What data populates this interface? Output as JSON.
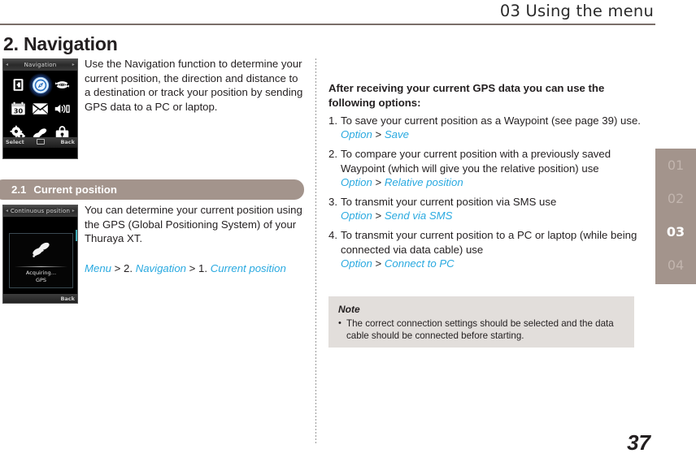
{
  "header": {
    "chapter_label": "03 Using the menu"
  },
  "section": {
    "title": "2. Navigation",
    "intro": "Use the Navigation function to determine your current position, the direction and distance to a destination or track your position by sending GPS data to a PC or laptop."
  },
  "subsection": {
    "number": "2.1",
    "title": "Current position",
    "body": "You can determine your current position using the GPS (Global Positioning System) of your Thuraya XT.",
    "path": {
      "menu": "Menu",
      "sep1": " > ",
      "step1_num": "2. ",
      "step1": "Navigation",
      "sep2": " > ",
      "step2_num": "1. ",
      "step2": "Current position"
    }
  },
  "phone_shots": [
    {
      "name": "navigation-menu-screen",
      "title": "Navigation",
      "arrow_left": "◂",
      "arrow_right": "▸",
      "icons": [
        "phonebook-icon",
        "compass-icon",
        "call-log-icon",
        "calendar-icon",
        "messages-icon",
        "sound-settings-icon",
        "settings-gear-icon",
        "satellite-icon",
        "security-lock-icon"
      ],
      "calendar_day": "30",
      "softkey_left": "Select",
      "softkey_middle": "menu-grid-icon",
      "softkey_right": "Back"
    },
    {
      "name": "continuous-position-screen",
      "title": "Continuous position",
      "arrow_left": "◂",
      "arrow_right": "▸",
      "status_icon": "satellite-icon",
      "status_line1": "Acquiring…",
      "status_line2": "GPS",
      "softkey_left": "",
      "softkey_right": "Back"
    }
  ],
  "options": {
    "lead": "After receiving your current GPS data you can use the following options:",
    "items": [
      {
        "index": "1.",
        "text": "To save your current position as a Waypoint (see page 39) use.",
        "path_prefix": "Option",
        "path_sep": " > ",
        "path_value": "Save"
      },
      {
        "index": "2.",
        "text": "To compare your current position with a previously saved Waypoint (which will give you the relative position) use",
        "path_prefix": "Option",
        "path_sep": " > ",
        "path_value": "Relative position"
      },
      {
        "index": "3.",
        "text": "To transmit your current position via SMS use",
        "path_prefix": "Option",
        "path_sep": " > ",
        "path_value": "Send via SMS"
      },
      {
        "index": "4.",
        "text": "To transmit your current position to a PC or laptop (while being connected via data cable) use",
        "path_prefix": "Option",
        "path_sep": " > ",
        "path_value": "Connect to PC"
      }
    ]
  },
  "note": {
    "title": "Note",
    "bullet": "•",
    "text": "The correct connection settings should be selected and the data cable should be connected before starting."
  },
  "tab_strip": {
    "items": [
      "01",
      "02",
      "03",
      "04"
    ],
    "active": "03"
  },
  "page_number": "37",
  "colors": {
    "link_blue": "#29a9e0",
    "accent_taupe": "#a3948c",
    "rule_brown": "#7a6e69",
    "note_bg": "#e2dedb",
    "text": "#231f20"
  }
}
